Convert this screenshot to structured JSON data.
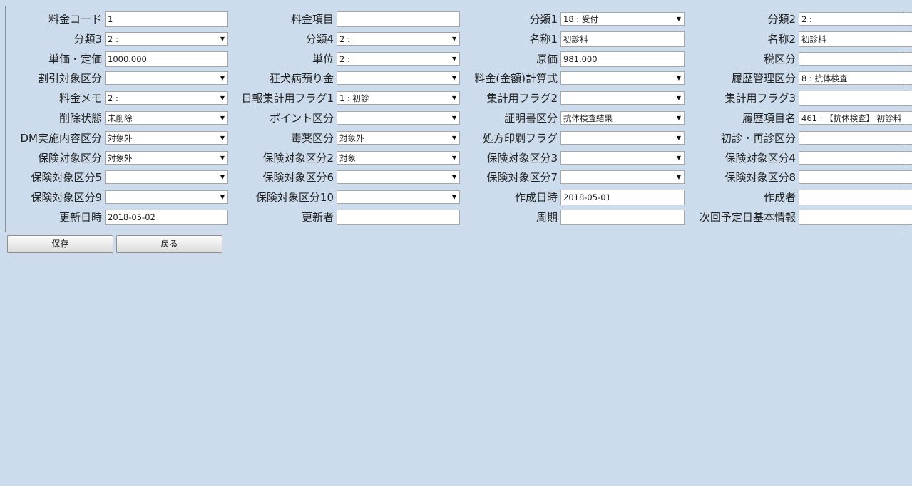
{
  "form": {
    "rows": [
      [
        {
          "label": "料金コード",
          "type": "input",
          "value": "1"
        },
        {
          "label": "料金項目",
          "type": "input",
          "value": ""
        },
        {
          "label": "分類1",
          "type": "select",
          "value": "18 : 受付"
        },
        {
          "label": "分類2",
          "type": "select",
          "value": "2 :"
        }
      ],
      [
        {
          "label": "分類3",
          "type": "select",
          "value": "2 :"
        },
        {
          "label": "分類4",
          "type": "select",
          "value": "2 :"
        },
        {
          "label": "名称1",
          "type": "input",
          "value": "初診料"
        },
        {
          "label": "名称2",
          "type": "input",
          "value": "初診料"
        }
      ],
      [
        {
          "label": "単価・定価",
          "type": "input",
          "value": "1000.000"
        },
        {
          "label": "単位",
          "type": "select",
          "value": "2 :"
        },
        {
          "label": "原価",
          "type": "input",
          "value": "981.000"
        },
        {
          "label": "税区分",
          "type": "select",
          "value": ""
        }
      ],
      [
        {
          "label": "割引対象区分",
          "type": "select",
          "value": ""
        },
        {
          "label": "狂犬病預り金",
          "type": "select",
          "value": ""
        },
        {
          "label": "料金(金額)計算式",
          "type": "select",
          "value": ""
        },
        {
          "label": "履歴管理区分",
          "type": "select",
          "value": "8 : 抗体検査"
        }
      ],
      [
        {
          "label": "料金メモ",
          "type": "select",
          "value": "2 :"
        },
        {
          "label": "日報集計用フラグ1",
          "type": "select",
          "value": "1 : 初診"
        },
        {
          "label": "集計用フラグ2",
          "type": "select",
          "value": ""
        },
        {
          "label": "集計用フラグ3",
          "type": "input",
          "value": ""
        }
      ],
      [
        {
          "label": "削除状態",
          "type": "select",
          "value": "未削除"
        },
        {
          "label": "ポイント区分",
          "type": "select",
          "value": ""
        },
        {
          "label": "証明書区分",
          "type": "select",
          "value": "抗体検査結果"
        },
        {
          "label": "履歴項目名",
          "type": "select",
          "value": "461 : 【抗体検査】 初診料"
        }
      ],
      [
        {
          "label": "DM実施内容区分",
          "type": "select",
          "value": "対象外"
        },
        {
          "label": "毒薬区分",
          "type": "select",
          "value": "対象外"
        },
        {
          "label": "処方印刷フラグ",
          "type": "select",
          "value": ""
        },
        {
          "label": "初診・再診区分",
          "type": "select",
          "value": ""
        }
      ],
      [
        {
          "label": "保険対象区分",
          "type": "select",
          "value": "対象外"
        },
        {
          "label": "保険対象区分2",
          "type": "select",
          "value": "対象"
        },
        {
          "label": "保険対象区分3",
          "type": "select",
          "value": ""
        },
        {
          "label": "保険対象区分4",
          "type": "select",
          "value": ""
        }
      ],
      [
        {
          "label": "保険対象区分5",
          "type": "select",
          "value": ""
        },
        {
          "label": "保険対象区分6",
          "type": "select",
          "value": ""
        },
        {
          "label": "保険対象区分7",
          "type": "select",
          "value": ""
        },
        {
          "label": "保険対象区分8",
          "type": "select",
          "value": ""
        }
      ],
      [
        {
          "label": "保険対象区分9",
          "type": "select",
          "value": ""
        },
        {
          "label": "保険対象区分10",
          "type": "select",
          "value": ""
        },
        {
          "label": "作成日時",
          "type": "input",
          "value": "2018-05-01"
        },
        {
          "label": "作成者",
          "type": "input",
          "value": ""
        }
      ],
      [
        {
          "label": "更新日時",
          "type": "input",
          "value": "2018-05-02"
        },
        {
          "label": "更新者",
          "type": "input",
          "value": ""
        },
        {
          "label": "周期",
          "type": "input",
          "value": ""
        },
        {
          "label": "次回予定日基本情報",
          "type": "input",
          "value": ""
        }
      ]
    ]
  },
  "buttons": {
    "save_label": "保存",
    "back_label": "戻る"
  },
  "icons": {
    "dropdown": "triangle-down-icon"
  },
  "colors": {
    "background": "#cddcec",
    "border": "#8a8f96"
  }
}
